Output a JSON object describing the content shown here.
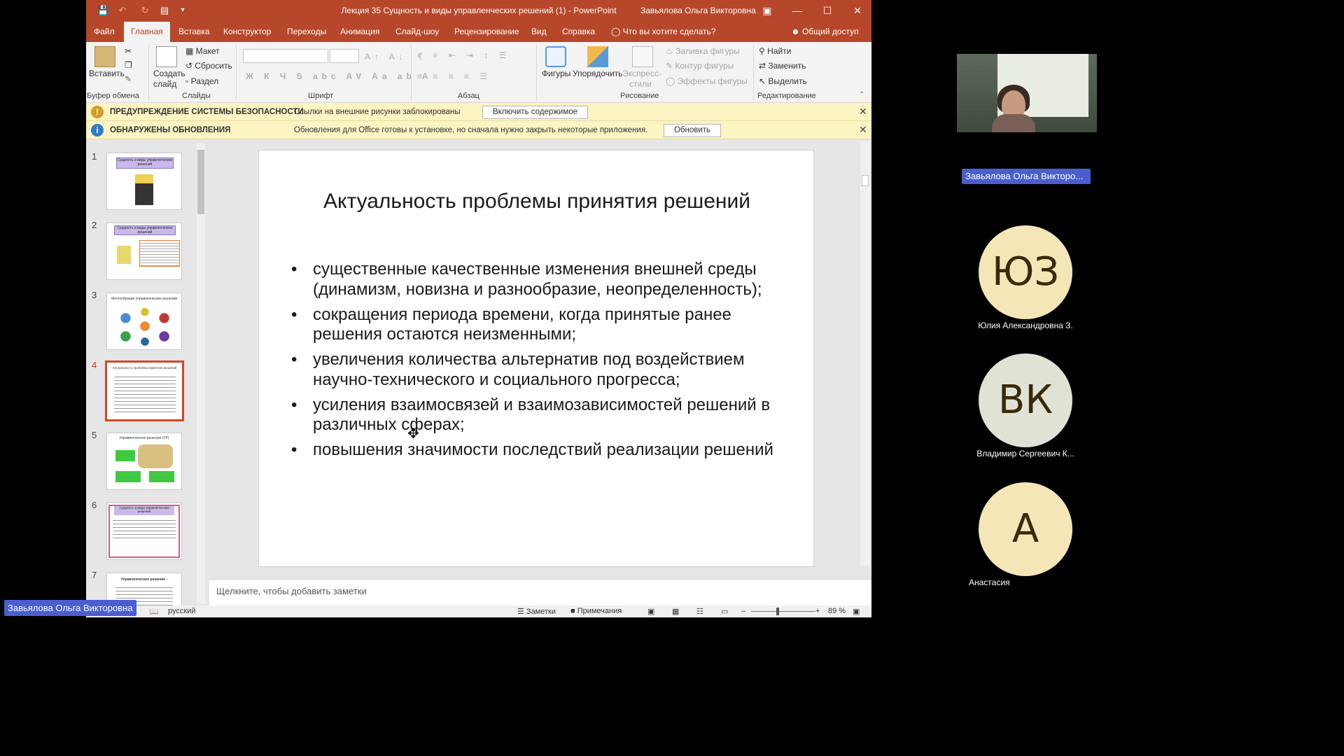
{
  "app": {
    "document_title": "Лекция 35 Сущность и виды управленческих решений (1)  -  PowerPoint",
    "user_name": "Завьялова Ольга Викторовна"
  },
  "ribbon_tabs": [
    "Файл",
    "Главная",
    "Вставка",
    "Конструктор",
    "Переходы",
    "Анимация",
    "Слайд-шоу",
    "Рецензирование",
    "Вид",
    "Справка"
  ],
  "tell_me": "Что вы хотите сделать?",
  "share": "Общий доступ",
  "ribbon": {
    "paste": "Вставить",
    "new_slide": "Создать слайд",
    "layout": "Макет",
    "reset": "Сбросить",
    "section": "Раздел",
    "shapes": "Фигуры",
    "arrange": "Упорядочить",
    "quick_styles": "Экспресс-стили",
    "shape_fill": "Заливка фигуры",
    "shape_outline": "Контур фигуры",
    "shape_effects": "Эффекты фигуры",
    "find": "Найти",
    "replace": "Заменить",
    "select": "Выделить",
    "groups": {
      "clipboard": "Буфер обмена",
      "slides": "Слайды",
      "font": "Шрифт",
      "paragraph": "Абзац",
      "drawing": "Рисование",
      "editing": "Редактирование"
    }
  },
  "security_bar": {
    "title": "ПРЕДУПРЕЖДЕНИЕ СИСТЕМЫ БЕЗОПАСНОСТИ",
    "text": "Ссылки на внешние рисунки заблокированы",
    "button": "Включить содержимое"
  },
  "update_bar": {
    "title": "ОБНАРУЖЕНЫ ОБНОВЛЕНИЯ",
    "text": "Обновления для Office готовы к установке, но сначала нужно закрыть некоторые приложения.",
    "button": "Обновить"
  },
  "thumbnails": [
    {
      "number": "1",
      "title": "Сущность и виды управленческих решений"
    },
    {
      "number": "2",
      "title": "Сущность и виды управленческих решений"
    },
    {
      "number": "3",
      "title": "Многообразие управленческих решений"
    },
    {
      "number": "4",
      "title": "Актуальность проблемы принятия решений"
    },
    {
      "number": "5",
      "title": "Управленческое решение (УР)"
    },
    {
      "number": "6",
      "title": "Сущность и виды управленческих решений"
    },
    {
      "number": "7",
      "title": "Управленческое решение -"
    }
  ],
  "current_slide": 4,
  "slide": {
    "title": "Актуальность проблемы принятия решений",
    "bullets": [
      "существенные качественные изменения внешней среды (динамизм, новизна и разнообразие, неопределенность);",
      " сокращения периода времени, когда принятые ранее решения остаются неизменными;",
      "увеличения количества альтернатив под воздействием научно-технического и социального прогресса;",
      "усиления взаимосвязей и взаимозависимостей решений в различных сферах;",
      "повышения значимости последствий реализации решений"
    ]
  },
  "notes_placeholder": "Щелкните, чтобы добавить заметки",
  "status": {
    "language": "русский",
    "notes": "Заметки",
    "comments": "Примечания",
    "zoom": "89 %"
  },
  "conference": {
    "speaker_label": "Завьялова Ольга Викторо...",
    "participants": [
      {
        "initials": "ЮЗ",
        "name": "Юлия Александровна З.",
        "color": "#f5e6b8"
      },
      {
        "initials": "ВК",
        "name": "Владимир Сергеевич К...",
        "color": "#dfe3d6"
      },
      {
        "initials": "А",
        "name": "Анастасия",
        "color": "#f5e6b8"
      }
    ],
    "bottom_label": "Завьялова Ольга Викторовна"
  },
  "colors": {
    "ppt_accent": "#b7472a",
    "selection": "#d24726",
    "message_bar": "#fcf4c3",
    "name_label": "#4a5ed2"
  }
}
